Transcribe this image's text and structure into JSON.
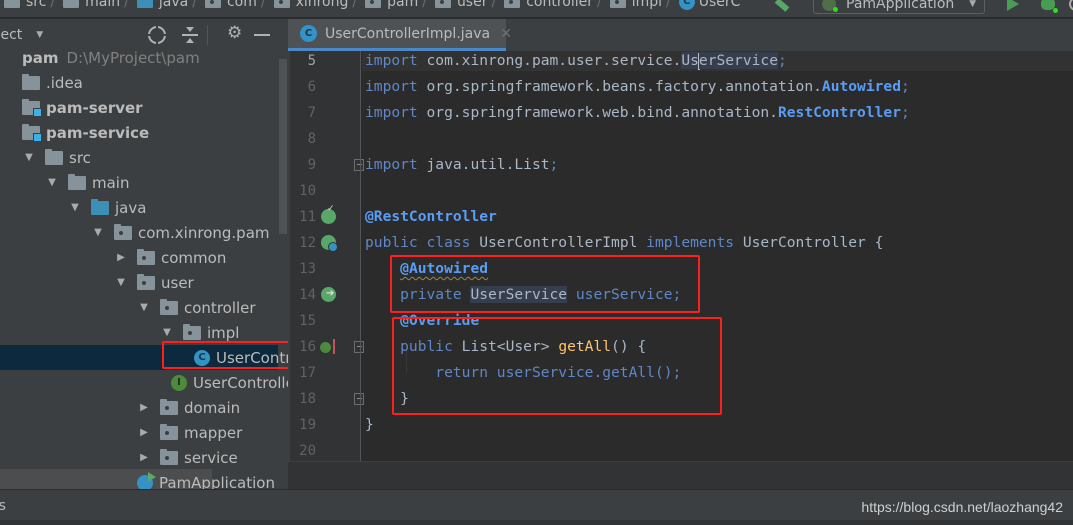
{
  "breadcrumb": {
    "items": [
      {
        "label": "src",
        "icon": "folder-icon"
      },
      {
        "label": "main",
        "icon": "folder-icon"
      },
      {
        "label": "java",
        "icon": "source-folder-icon"
      },
      {
        "label": "com",
        "icon": "package-icon"
      },
      {
        "label": "xinrong",
        "icon": "package-icon"
      },
      {
        "label": "pam",
        "icon": "package-icon"
      },
      {
        "label": "user",
        "icon": "package-icon"
      },
      {
        "label": "controller",
        "icon": "package-icon"
      },
      {
        "label": "impl",
        "icon": "package-icon"
      },
      {
        "label": "UserC",
        "icon": "class-icon"
      }
    ],
    "separator": "/"
  },
  "toolbar": {
    "run_config": "PamApplication",
    "run_config_caret": "▼"
  },
  "project_panel": {
    "title": "oject",
    "caret": "▼",
    "gear_glyph": "⚙",
    "tree": [
      {
        "label": "pam",
        "extra": "D:\\MyProject\\pam",
        "level": 0,
        "type": "root",
        "arrow": ""
      },
      {
        "label": ".idea",
        "level": 0,
        "type": "folder",
        "arrow": ""
      },
      {
        "label": "pam-server",
        "level": 0,
        "type": "module",
        "arrow": "",
        "bold": true
      },
      {
        "label": "pam-service",
        "level": 0,
        "type": "module",
        "arrow": "",
        "bold": true
      },
      {
        "label": "src",
        "level": 1,
        "type": "folder",
        "arrow": "▼"
      },
      {
        "label": "main",
        "level": 2,
        "type": "folder",
        "arrow": "▼"
      },
      {
        "label": "java",
        "level": 3,
        "type": "source-folder",
        "arrow": "▼"
      },
      {
        "label": "com.xinrong.pam",
        "level": 4,
        "type": "package",
        "arrow": "▼"
      },
      {
        "label": "common",
        "level": 5,
        "type": "package",
        "arrow": "▶"
      },
      {
        "label": "user",
        "level": 5,
        "type": "package",
        "arrow": "▼"
      },
      {
        "label": "controller",
        "level": 6,
        "type": "package",
        "arrow": "▼"
      },
      {
        "label": "impl",
        "level": 7,
        "type": "package",
        "arrow": "▼"
      },
      {
        "label": "UserControl",
        "level": 8,
        "type": "class",
        "arrow": "",
        "selected": true
      },
      {
        "label": "UserController",
        "level": 7,
        "type": "interface",
        "arrow": ""
      },
      {
        "label": "domain",
        "level": 6,
        "type": "package",
        "arrow": "▶"
      },
      {
        "label": "mapper",
        "level": 6,
        "type": "package",
        "arrow": "▶"
      },
      {
        "label": "service",
        "level": 6,
        "type": "package",
        "arrow": "▶"
      },
      {
        "label": "PamApplication",
        "level": 5,
        "type": "app",
        "arrow": ""
      }
    ]
  },
  "editor": {
    "tab": {
      "label": "UserControllerImpl.java",
      "icon_letter": "C",
      "close": "✕"
    },
    "lines": [
      {
        "n": "5",
        "tokens": [
          {
            "t": "import ",
            "c": "kw"
          },
          {
            "t": "com.xinrong.pam.user.service.",
            "c": "plain"
          },
          {
            "t": "Us",
            "c": "usage-hl"
          },
          {
            "t": "CURSOR",
            "c": "cursor"
          },
          {
            "t": "erService",
            "c": "usage-hl"
          },
          {
            "t": ";",
            "c": "kw"
          }
        ]
      },
      {
        "n": "6",
        "tokens": [
          {
            "t": "import ",
            "c": "kw"
          },
          {
            "t": "org.springframework.beans.factory.annotation.",
            "c": "plain"
          },
          {
            "t": "Autowired",
            "c": "ann"
          },
          {
            "t": ";",
            "c": "kw"
          }
        ]
      },
      {
        "n": "7",
        "tokens": [
          {
            "t": "import ",
            "c": "kw"
          },
          {
            "t": "org.springframework.web.bind.annotation.",
            "c": "plain"
          },
          {
            "t": "RestController",
            "c": "ann"
          },
          {
            "t": ";",
            "c": "kw"
          }
        ]
      },
      {
        "n": "8",
        "tokens": []
      },
      {
        "n": "9",
        "tokens": [
          {
            "t": "import ",
            "c": "kw"
          },
          {
            "t": "java.util.List",
            "c": "plain"
          },
          {
            "t": ";",
            "c": "kw"
          }
        ]
      },
      {
        "n": "10",
        "tokens": []
      },
      {
        "n": "11",
        "tokens": [
          {
            "t": "@RestController",
            "c": "ann"
          }
        ]
      },
      {
        "n": "12",
        "tokens": [
          {
            "t": "public class ",
            "c": "kw"
          },
          {
            "t": "UserControllerImpl ",
            "c": "plain"
          },
          {
            "t": "implements ",
            "c": "kw"
          },
          {
            "t": "UserController {",
            "c": "plain"
          }
        ]
      },
      {
        "n": "13",
        "tokens": [
          {
            "t": "    ",
            "c": "plain"
          },
          {
            "t": "@Autowired",
            "c": "ann warn"
          }
        ]
      },
      {
        "n": "14",
        "tokens": [
          {
            "t": "    private ",
            "c": "kw"
          },
          {
            "t": "UserService",
            "c": "usage-hl"
          },
          {
            "t": " userService;",
            "c": "kw"
          }
        ]
      },
      {
        "n": "15",
        "tokens": [
          {
            "t": "    ",
            "c": "plain"
          },
          {
            "t": "@Override",
            "c": "ann"
          }
        ]
      },
      {
        "n": "16",
        "tokens": [
          {
            "t": "    public ",
            "c": "kw"
          },
          {
            "t": "List<User> ",
            "c": "plain"
          },
          {
            "t": "getAll",
            "c": "fn"
          },
          {
            "t": "() {",
            "c": "plain"
          }
        ]
      },
      {
        "n": "17",
        "tokens": [
          {
            "t": "        return ",
            "c": "kw"
          },
          {
            "t": "userService.getAll();",
            "c": "kw"
          }
        ]
      },
      {
        "n": "18",
        "tokens": [
          {
            "t": "    }",
            "c": "plain"
          }
        ]
      },
      {
        "n": "19",
        "tokens": [
          {
            "t": "}",
            "c": "plain"
          }
        ]
      },
      {
        "n": "20",
        "tokens": []
      }
    ],
    "gutter_icons": [
      {
        "line": "11",
        "icon": "spring-controller-icon"
      },
      {
        "line": "12",
        "icon": "spring-bean-icon"
      },
      {
        "line": "14",
        "icon": "autowired-navigate-icon"
      },
      {
        "line": "16",
        "icon": "implements-method-icon"
      }
    ]
  },
  "statusbar": {
    "left": "es",
    "watermark": "https://blog.csdn.net/laozhang42"
  }
}
